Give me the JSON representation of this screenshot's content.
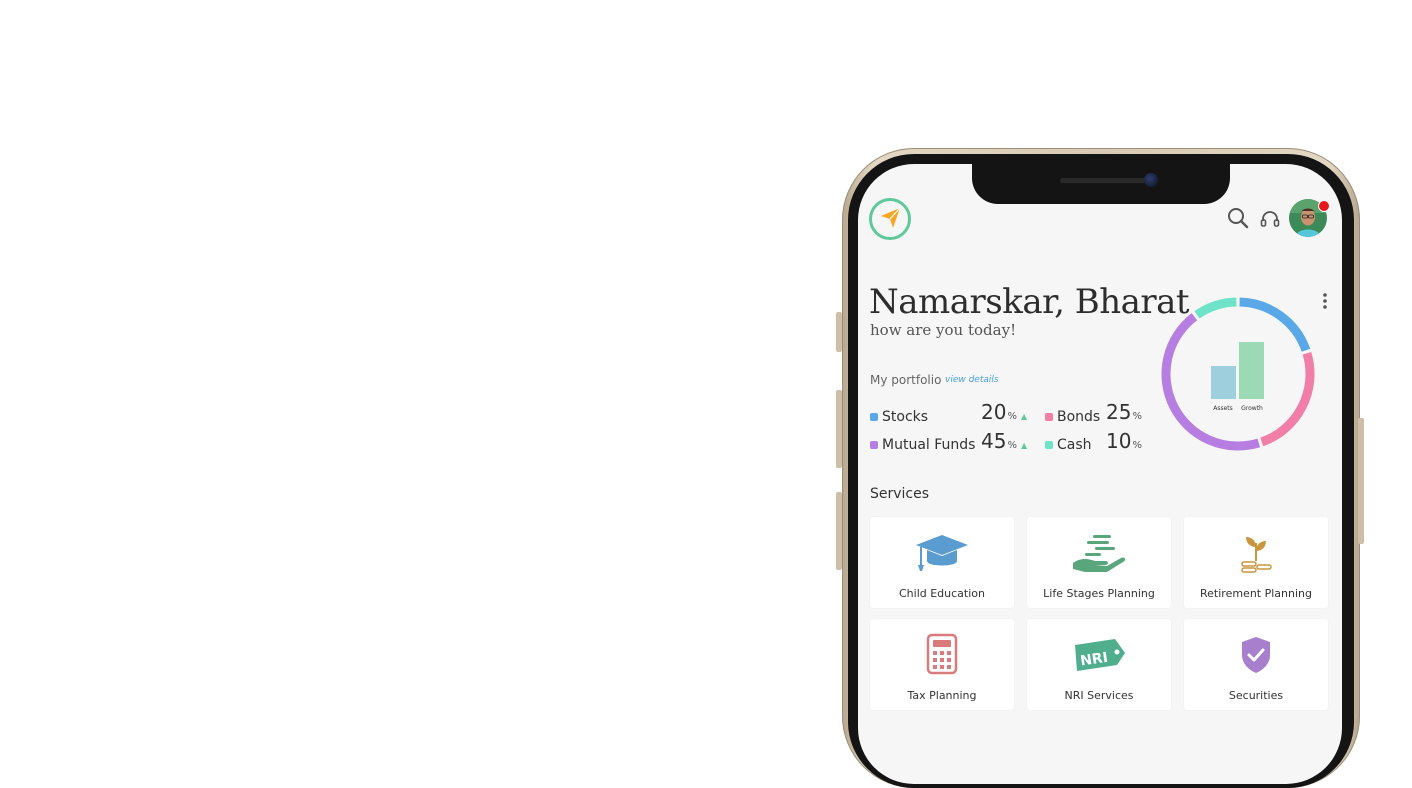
{
  "header": {
    "logo": "paper-plane-logo",
    "icons": [
      "search-icon",
      "headset-icon"
    ],
    "avatar": "user-avatar",
    "notification_color": "#e8171b"
  },
  "greeting": {
    "title": "Namarskar, Bharat",
    "subtitle": "how are you today!"
  },
  "portfolio": {
    "label": "My portfolio",
    "link": "view details",
    "items": [
      {
        "name": "Stocks",
        "value": "20",
        "unit": "%",
        "trend": "▲",
        "color": "#5aa8e8"
      },
      {
        "name": "Bonds",
        "value": "25",
        "unit": "%",
        "trend": "",
        "color": "#f07ea7"
      },
      {
        "name": "Mutual Funds",
        "value": "45",
        "unit": "%",
        "trend": "▲",
        "color": "#b67ee0"
      },
      {
        "name": "Cash",
        "value": "10",
        "unit": "%",
        "trend": "",
        "color": "#6fe3c8"
      }
    ]
  },
  "chart_data": {
    "type": "pie",
    "categories": [
      "Stocks",
      "Bonds",
      "Mutual Funds",
      "Cash"
    ],
    "values": [
      20,
      25,
      45,
      10
    ],
    "colors": [
      "#5aa8e8",
      "#f07ea7",
      "#b67ee0",
      "#6fe3c8"
    ],
    "center_bars": {
      "categories": [
        "Assets",
        "Growth"
      ],
      "colors": [
        "#9ecfdc",
        "#9bdab4"
      ]
    }
  },
  "services": {
    "title": "Services",
    "items": [
      {
        "label": "Child Education",
        "icon": "graduation-cap-icon",
        "color": "#5a9bd0"
      },
      {
        "label": "Life Stages Planning",
        "icon": "hand-money-icon",
        "color": "#5aa67c"
      },
      {
        "label": "Retirement Planning",
        "icon": "plant-coins-icon",
        "color": "#c8973d"
      },
      {
        "label": "Tax Planning",
        "icon": "calculator-icon",
        "color": "#d97b7b"
      },
      {
        "label": "NRI Services",
        "icon": "nri-tag-icon",
        "color": "#4fae8c"
      },
      {
        "label": "Securities",
        "icon": "shield-check-icon",
        "color": "#a77fcc"
      }
    ]
  }
}
